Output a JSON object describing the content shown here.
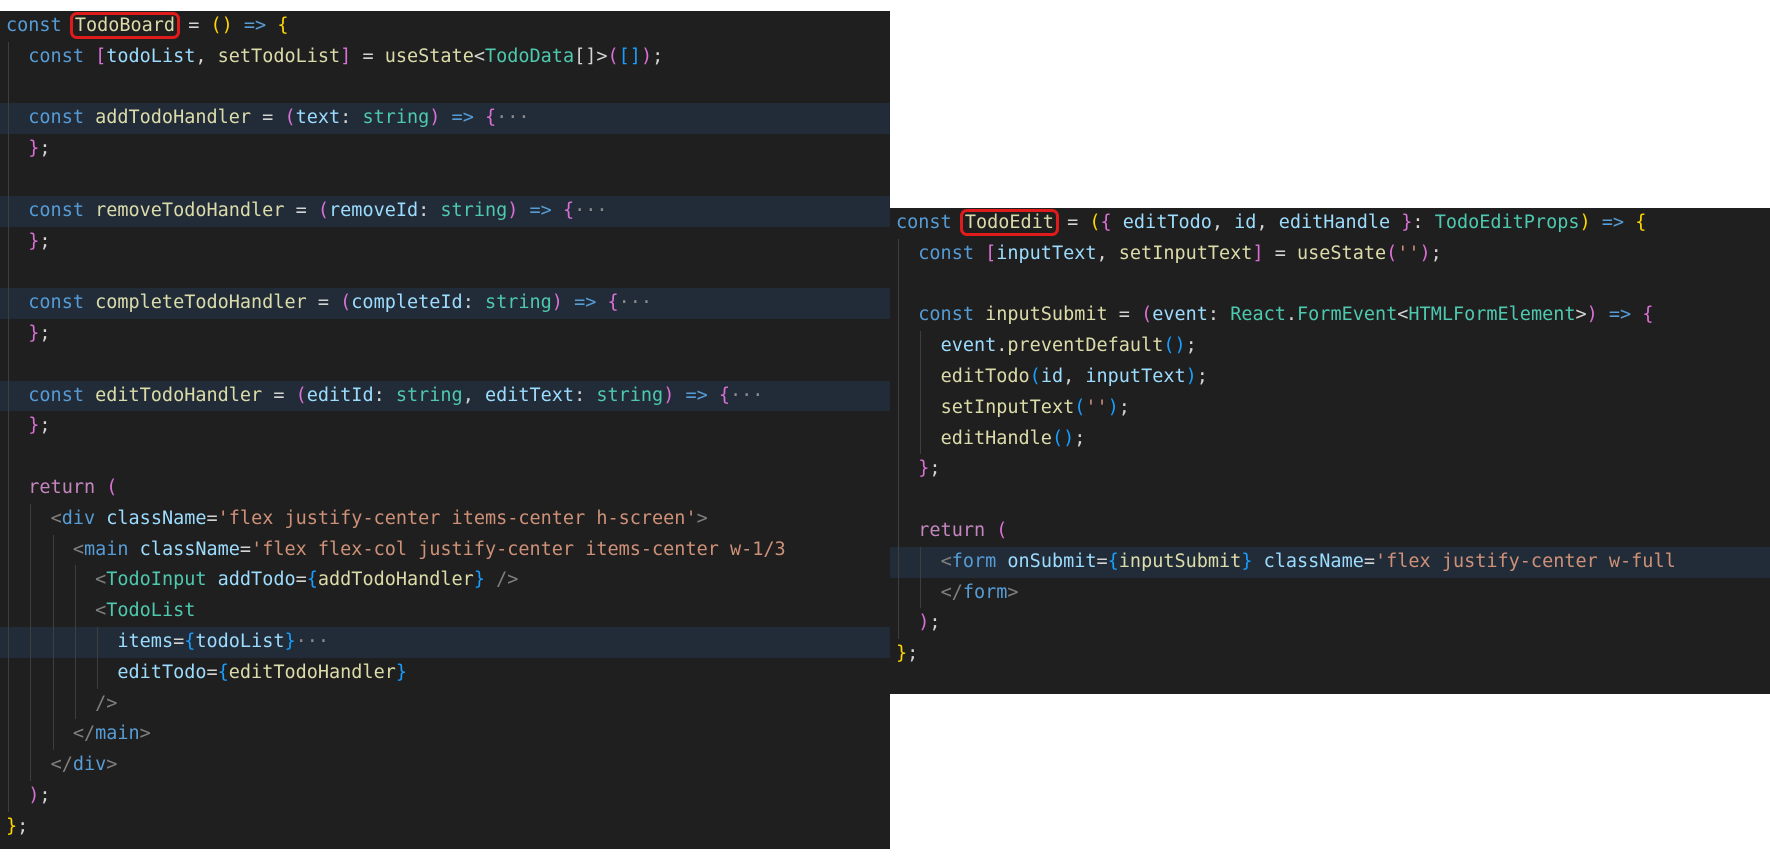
{
  "colors": {
    "editor_background": "#1f1f1f",
    "highlight_line": "#222c38",
    "name_box": "#e01b1b",
    "keyword": "#569cd6",
    "control": "#c586c0",
    "function": "#dcdcaa",
    "variable": "#9cdcfe",
    "type": "#4ec9b0",
    "string": "#ce9178"
  },
  "left_panel": {
    "highlighted_component": "TodoBoard",
    "lines": [
      {
        "indent": 0,
        "tokens": [
          {
            "t": "const ",
            "c": "kw"
          },
          {
            "t": "TodoBoard",
            "c": "fn",
            "box": true
          },
          {
            "t": " = ",
            "c": "op"
          },
          {
            "t": "()",
            "c": "p1"
          },
          {
            "t": " => ",
            "c": "kw"
          },
          {
            "t": "{",
            "c": "p1"
          }
        ]
      },
      {
        "indent": 1,
        "tokens": [
          {
            "t": "const ",
            "c": "kw"
          },
          {
            "t": "[",
            "c": "p2"
          },
          {
            "t": "todoList",
            "c": "var"
          },
          {
            "t": ", ",
            "c": "op"
          },
          {
            "t": "setTodoList",
            "c": "fn"
          },
          {
            "t": "]",
            "c": "p2"
          },
          {
            "t": " = ",
            "c": "op"
          },
          {
            "t": "useState",
            "c": "fn"
          },
          {
            "t": "<",
            "c": "op"
          },
          {
            "t": "TodoData",
            "c": "type"
          },
          {
            "t": "[]",
            "c": "op"
          },
          {
            "t": ">",
            "c": "op"
          },
          {
            "t": "(",
            "c": "p2"
          },
          {
            "t": "[]",
            "c": "p3"
          },
          {
            "t": ")",
            "c": "p2"
          },
          {
            "t": ";",
            "c": "op"
          }
        ]
      },
      {
        "indent": 0,
        "tokens": []
      },
      {
        "indent": 1,
        "hl": true,
        "tokens": [
          {
            "t": "const ",
            "c": "kw"
          },
          {
            "t": "addTodoHandler",
            "c": "fn"
          },
          {
            "t": " = ",
            "c": "op"
          },
          {
            "t": "(",
            "c": "p2"
          },
          {
            "t": "text",
            "c": "var"
          },
          {
            "t": ": ",
            "c": "op"
          },
          {
            "t": "string",
            "c": "type"
          },
          {
            "t": ")",
            "c": "p2"
          },
          {
            "t": " => ",
            "c": "kw"
          },
          {
            "t": "{",
            "c": "p2"
          },
          {
            "t": "···",
            "c": "fold"
          }
        ]
      },
      {
        "indent": 1,
        "tokens": [
          {
            "t": "}",
            "c": "p2"
          },
          {
            "t": ";",
            "c": "op"
          }
        ]
      },
      {
        "indent": 0,
        "tokens": []
      },
      {
        "indent": 1,
        "hl": true,
        "tokens": [
          {
            "t": "const ",
            "c": "kw"
          },
          {
            "t": "removeTodoHandler",
            "c": "fn"
          },
          {
            "t": " = ",
            "c": "op"
          },
          {
            "t": "(",
            "c": "p2"
          },
          {
            "t": "removeId",
            "c": "var"
          },
          {
            "t": ": ",
            "c": "op"
          },
          {
            "t": "string",
            "c": "type"
          },
          {
            "t": ")",
            "c": "p2"
          },
          {
            "t": " => ",
            "c": "kw"
          },
          {
            "t": "{",
            "c": "p2"
          },
          {
            "t": "···",
            "c": "fold"
          }
        ]
      },
      {
        "indent": 1,
        "tokens": [
          {
            "t": "}",
            "c": "p2"
          },
          {
            "t": ";",
            "c": "op"
          }
        ]
      },
      {
        "indent": 0,
        "tokens": []
      },
      {
        "indent": 1,
        "hl": true,
        "tokens": [
          {
            "t": "const ",
            "c": "kw"
          },
          {
            "t": "completeTodoHandler",
            "c": "fn"
          },
          {
            "t": " = ",
            "c": "op"
          },
          {
            "t": "(",
            "c": "p2"
          },
          {
            "t": "completeId",
            "c": "var"
          },
          {
            "t": ": ",
            "c": "op"
          },
          {
            "t": "string",
            "c": "type"
          },
          {
            "t": ")",
            "c": "p2"
          },
          {
            "t": " => ",
            "c": "kw"
          },
          {
            "t": "{",
            "c": "p2"
          },
          {
            "t": "···",
            "c": "fold"
          }
        ]
      },
      {
        "indent": 1,
        "tokens": [
          {
            "t": "}",
            "c": "p2"
          },
          {
            "t": ";",
            "c": "op"
          }
        ]
      },
      {
        "indent": 0,
        "tokens": []
      },
      {
        "indent": 1,
        "hl": true,
        "tokens": [
          {
            "t": "const ",
            "c": "kw"
          },
          {
            "t": "editTodoHandler",
            "c": "fn"
          },
          {
            "t": " = ",
            "c": "op"
          },
          {
            "t": "(",
            "c": "p2"
          },
          {
            "t": "editId",
            "c": "var"
          },
          {
            "t": ": ",
            "c": "op"
          },
          {
            "t": "string",
            "c": "type"
          },
          {
            "t": ", ",
            "c": "op"
          },
          {
            "t": "editText",
            "c": "var"
          },
          {
            "t": ": ",
            "c": "op"
          },
          {
            "t": "string",
            "c": "type"
          },
          {
            "t": ")",
            "c": "p2"
          },
          {
            "t": " => ",
            "c": "kw"
          },
          {
            "t": "{",
            "c": "p2"
          },
          {
            "t": "···",
            "c": "fold"
          }
        ]
      },
      {
        "indent": 1,
        "tokens": [
          {
            "t": "}",
            "c": "p2"
          },
          {
            "t": ";",
            "c": "op"
          }
        ]
      },
      {
        "indent": 0,
        "tokens": []
      },
      {
        "indent": 1,
        "tokens": [
          {
            "t": "return ",
            "c": "ctl"
          },
          {
            "t": "(",
            "c": "p2"
          }
        ]
      },
      {
        "indent": 2,
        "tokens": [
          {
            "t": "<",
            "c": "ang"
          },
          {
            "t": "div",
            "c": "tag"
          },
          {
            "t": " ",
            "c": "op"
          },
          {
            "t": "className",
            "c": "attr"
          },
          {
            "t": "=",
            "c": "op"
          },
          {
            "t": "'flex justify-center items-center h-screen'",
            "c": "str"
          },
          {
            "t": ">",
            "c": "ang"
          }
        ]
      },
      {
        "indent": 3,
        "tokens": [
          {
            "t": "<",
            "c": "ang"
          },
          {
            "t": "main",
            "c": "tag"
          },
          {
            "t": " ",
            "c": "op"
          },
          {
            "t": "className",
            "c": "attr"
          },
          {
            "t": "=",
            "c": "op"
          },
          {
            "t": "'flex flex-col justify-center items-center w-1/3",
            "c": "str"
          }
        ]
      },
      {
        "indent": 4,
        "tokens": [
          {
            "t": "<",
            "c": "ang"
          },
          {
            "t": "TodoInput",
            "c": "comp"
          },
          {
            "t": " ",
            "c": "op"
          },
          {
            "t": "addTodo",
            "c": "attr"
          },
          {
            "t": "=",
            "c": "op"
          },
          {
            "t": "{",
            "c": "p3"
          },
          {
            "t": "addTodoHandler",
            "c": "fn"
          },
          {
            "t": "}",
            "c": "p3"
          },
          {
            "t": " />",
            "c": "ang"
          }
        ]
      },
      {
        "indent": 4,
        "tokens": [
          {
            "t": "<",
            "c": "ang"
          },
          {
            "t": "TodoList",
            "c": "comp"
          }
        ]
      },
      {
        "indent": 5,
        "hl": true,
        "tokens": [
          {
            "t": "items",
            "c": "attr"
          },
          {
            "t": "=",
            "c": "op"
          },
          {
            "t": "{",
            "c": "p3"
          },
          {
            "t": "todoList",
            "c": "var"
          },
          {
            "t": "}",
            "c": "p3"
          },
          {
            "t": "···",
            "c": "fold"
          }
        ]
      },
      {
        "indent": 5,
        "tokens": [
          {
            "t": "editTodo",
            "c": "attr"
          },
          {
            "t": "=",
            "c": "op"
          },
          {
            "t": "{",
            "c": "p3"
          },
          {
            "t": "editTodoHandler",
            "c": "fn"
          },
          {
            "t": "}",
            "c": "p3"
          }
        ]
      },
      {
        "indent": 4,
        "tokens": [
          {
            "t": "/>",
            "c": "ang"
          }
        ]
      },
      {
        "indent": 3,
        "tokens": [
          {
            "t": "</",
            "c": "ang"
          },
          {
            "t": "main",
            "c": "tag"
          },
          {
            "t": ">",
            "c": "ang"
          }
        ]
      },
      {
        "indent": 2,
        "tokens": [
          {
            "t": "</",
            "c": "ang"
          },
          {
            "t": "div",
            "c": "tag"
          },
          {
            "t": ">",
            "c": "ang"
          }
        ]
      },
      {
        "indent": 1,
        "tokens": [
          {
            "t": ")",
            "c": "p2"
          },
          {
            "t": ";",
            "c": "op"
          }
        ]
      },
      {
        "indent": 0,
        "tokens": [
          {
            "t": "}",
            "c": "p1"
          },
          {
            "t": ";",
            "c": "op"
          }
        ]
      }
    ]
  },
  "right_panel": {
    "highlighted_component": "TodoEdit",
    "lines": [
      {
        "indent": 0,
        "tokens": [
          {
            "t": "const ",
            "c": "kw"
          },
          {
            "t": "TodoEdit",
            "c": "fn",
            "box": true
          },
          {
            "t": " = ",
            "c": "op"
          },
          {
            "t": "(",
            "c": "p1"
          },
          {
            "t": "{",
            "c": "p2"
          },
          {
            "t": " editTodo",
            "c": "var"
          },
          {
            "t": ", ",
            "c": "op"
          },
          {
            "t": "id",
            "c": "var"
          },
          {
            "t": ", ",
            "c": "op"
          },
          {
            "t": "editHandle",
            "c": "var"
          },
          {
            "t": " }",
            "c": "p2"
          },
          {
            "t": ": ",
            "c": "op"
          },
          {
            "t": "TodoEditProps",
            "c": "type"
          },
          {
            "t": ")",
            "c": "p1"
          },
          {
            "t": " => ",
            "c": "kw"
          },
          {
            "t": "{",
            "c": "p1"
          }
        ]
      },
      {
        "indent": 1,
        "tokens": [
          {
            "t": "const ",
            "c": "kw"
          },
          {
            "t": "[",
            "c": "p2"
          },
          {
            "t": "inputText",
            "c": "var"
          },
          {
            "t": ", ",
            "c": "op"
          },
          {
            "t": "setInputText",
            "c": "fn"
          },
          {
            "t": "]",
            "c": "p2"
          },
          {
            "t": " = ",
            "c": "op"
          },
          {
            "t": "useState",
            "c": "fn"
          },
          {
            "t": "(",
            "c": "p2"
          },
          {
            "t": "''",
            "c": "str"
          },
          {
            "t": ")",
            "c": "p2"
          },
          {
            "t": ";",
            "c": "op"
          }
        ]
      },
      {
        "indent": 0,
        "tokens": []
      },
      {
        "indent": 1,
        "tokens": [
          {
            "t": "const ",
            "c": "kw"
          },
          {
            "t": "inputSubmit",
            "c": "fn"
          },
          {
            "t": " = ",
            "c": "op"
          },
          {
            "t": "(",
            "c": "p2"
          },
          {
            "t": "event",
            "c": "var"
          },
          {
            "t": ": ",
            "c": "op"
          },
          {
            "t": "React",
            "c": "type"
          },
          {
            "t": ".",
            "c": "op"
          },
          {
            "t": "FormEvent",
            "c": "type"
          },
          {
            "t": "<",
            "c": "op"
          },
          {
            "t": "HTMLFormElement",
            "c": "type"
          },
          {
            "t": ">",
            "c": "op"
          },
          {
            "t": ")",
            "c": "p2"
          },
          {
            "t": " => ",
            "c": "kw"
          },
          {
            "t": "{",
            "c": "p2"
          }
        ]
      },
      {
        "indent": 2,
        "tokens": [
          {
            "t": "event",
            "c": "var"
          },
          {
            "t": ".",
            "c": "op"
          },
          {
            "t": "preventDefault",
            "c": "fn"
          },
          {
            "t": "()",
            "c": "p3"
          },
          {
            "t": ";",
            "c": "op"
          }
        ]
      },
      {
        "indent": 2,
        "tokens": [
          {
            "t": "editTodo",
            "c": "fn"
          },
          {
            "t": "(",
            "c": "p3"
          },
          {
            "t": "id",
            "c": "var"
          },
          {
            "t": ", ",
            "c": "op"
          },
          {
            "t": "inputText",
            "c": "var"
          },
          {
            "t": ")",
            "c": "p3"
          },
          {
            "t": ";",
            "c": "op"
          }
        ]
      },
      {
        "indent": 2,
        "tokens": [
          {
            "t": "setInputText",
            "c": "fn"
          },
          {
            "t": "(",
            "c": "p3"
          },
          {
            "t": "''",
            "c": "str"
          },
          {
            "t": ")",
            "c": "p3"
          },
          {
            "t": ";",
            "c": "op"
          }
        ]
      },
      {
        "indent": 2,
        "tokens": [
          {
            "t": "editHandle",
            "c": "fn"
          },
          {
            "t": "()",
            "c": "p3"
          },
          {
            "t": ";",
            "c": "op"
          }
        ]
      },
      {
        "indent": 1,
        "tokens": [
          {
            "t": "}",
            "c": "p2"
          },
          {
            "t": ";",
            "c": "op"
          }
        ]
      },
      {
        "indent": 0,
        "tokens": []
      },
      {
        "indent": 1,
        "tokens": [
          {
            "t": "return ",
            "c": "ctl"
          },
          {
            "t": "(",
            "c": "p2"
          }
        ]
      },
      {
        "indent": 2,
        "hl": true,
        "tokens": [
          {
            "t": "<",
            "c": "ang"
          },
          {
            "t": "form",
            "c": "tag"
          },
          {
            "t": " ",
            "c": "op"
          },
          {
            "t": "onSubmit",
            "c": "attr"
          },
          {
            "t": "=",
            "c": "op"
          },
          {
            "t": "{",
            "c": "p3"
          },
          {
            "t": "inputSubmit",
            "c": "fn"
          },
          {
            "t": "}",
            "c": "p3"
          },
          {
            "t": " ",
            "c": "op"
          },
          {
            "t": "className",
            "c": "attr"
          },
          {
            "t": "=",
            "c": "op"
          },
          {
            "t": "'flex justify-center w-full",
            "c": "str"
          }
        ]
      },
      {
        "indent": 2,
        "tokens": [
          {
            "t": "</",
            "c": "ang"
          },
          {
            "t": "form",
            "c": "tag"
          },
          {
            "t": ">",
            "c": "ang"
          }
        ]
      },
      {
        "indent": 1,
        "tokens": [
          {
            "t": ")",
            "c": "p2"
          },
          {
            "t": ";",
            "c": "op"
          }
        ]
      },
      {
        "indent": 0,
        "tokens": [
          {
            "t": "}",
            "c": "p1"
          },
          {
            "t": ";",
            "c": "op"
          }
        ]
      }
    ]
  }
}
